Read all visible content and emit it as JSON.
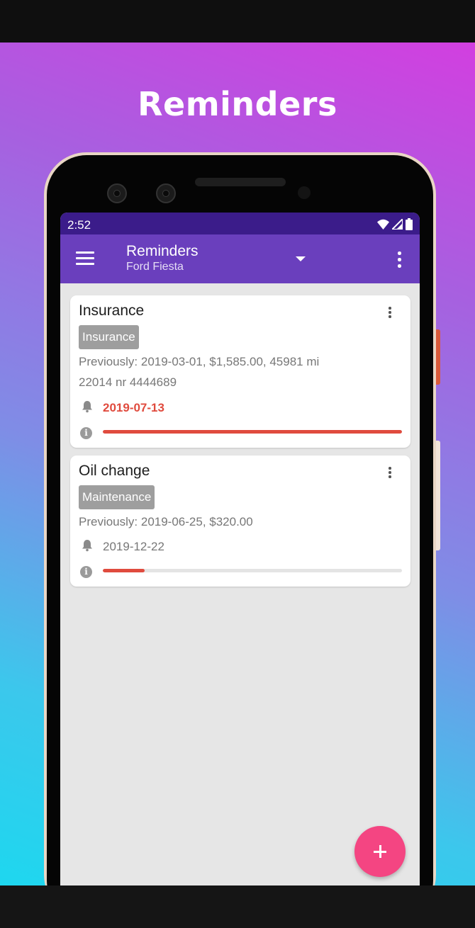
{
  "promo": {
    "title": "Reminders"
  },
  "status_bar": {
    "time": "2:52"
  },
  "app_bar": {
    "title": "Reminders",
    "subtitle": "Ford Fiesta"
  },
  "colors": {
    "accent_red": "#e04b3e",
    "app_bar": "#6a3fbd",
    "status_bar": "#3b1c8a",
    "fab": "#f44582"
  },
  "reminders": [
    {
      "title": "Insurance",
      "category": "Insurance",
      "details": [
        "Previously: 2019-03-01, $1,585.00, 45981 mi",
        "22014 nr 4444689"
      ],
      "due_date": "2019-07-13",
      "overdue": true,
      "progress": 1.0
    },
    {
      "title": "Oil change",
      "category": "Maintenance",
      "details": [
        "Previously: 2019-06-25, $320.00"
      ],
      "due_date": "2019-12-22",
      "overdue": false,
      "progress": 0.14
    }
  ],
  "icons": [
    "menu-icon",
    "dropdown-icon",
    "more-vert-icon",
    "bell-icon",
    "info-icon",
    "add-icon",
    "wifi-icon",
    "signal-icon",
    "battery-icon"
  ]
}
